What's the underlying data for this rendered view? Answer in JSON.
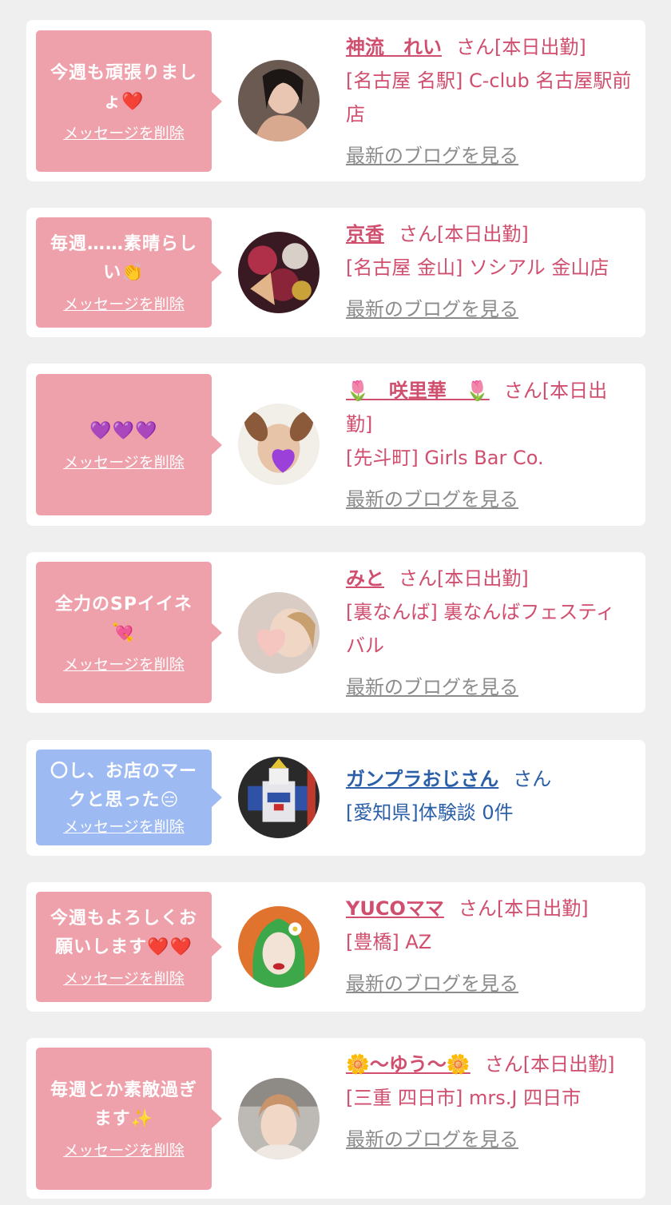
{
  "common": {
    "delete_label": "メッセージを削除",
    "blog_label": "最新のブログを見る"
  },
  "colors": {
    "pink_bubble": "#eea1ab",
    "blue_bubble": "#9dbaf2",
    "pink_text": "#d04e6e",
    "blue_text": "#2b5fa8",
    "gray_link": "#8c8c8c",
    "background": "#efefef"
  },
  "items": [
    {
      "message": "今週も頑張りましょ",
      "message_emoji": "❤️",
      "name": "神流　れい",
      "suffix": "さん[本日出勤]",
      "shop": "[名古屋 名駅] C-club 名古屋駅前店",
      "avatar_icon": "woman-photo-avatar"
    },
    {
      "message": "毎週……素晴らしい",
      "message_emoji": "👏",
      "name": "京香",
      "suffix": "さん[本日出勤]",
      "shop": "[名古屋 金山] ソシアル 金山店",
      "avatar_icon": "kimono-photo-avatar"
    },
    {
      "message": "",
      "message_emoji": "💜💜💜",
      "name": "🌷　咲里華　🌷",
      "suffix": "さん[本日出勤]",
      "shop": "[先斗町] Girls Bar Co.",
      "avatar_icon": "dog-filter-photo-avatar"
    },
    {
      "message": "全力のSPイイネ",
      "message_emoji": "💘",
      "name": "みと",
      "suffix": "さん[本日出勤]",
      "shop": "[裏なんば] 裏なんばフェスティバル",
      "avatar_icon": "heart-covered-photo-avatar"
    },
    {
      "message": "〇し、お店のマークと思った",
      "message_emoji": "😑",
      "name": "ガンプラおじさん",
      "suffix": "さん",
      "shop": "[愛知県]体験談 0件",
      "avatar_icon": "robot-model-avatar"
    },
    {
      "message": "今週もよろしくお願いします",
      "message_emoji": "❤️❤️",
      "name": "YUCOママ",
      "suffix": "さん[本日出勤]",
      "shop": "[豊橋] AZ",
      "avatar_icon": "illustrated-woman-avatar"
    },
    {
      "message": "毎週とか素敵過ぎます",
      "message_emoji": "✨",
      "name": "🌼〜ゆう〜🌼",
      "suffix": "さん[本日出勤]",
      "shop": "[三重 四日市] mrs.J 四日市",
      "avatar_icon": "car-selfie-avatar"
    }
  ]
}
